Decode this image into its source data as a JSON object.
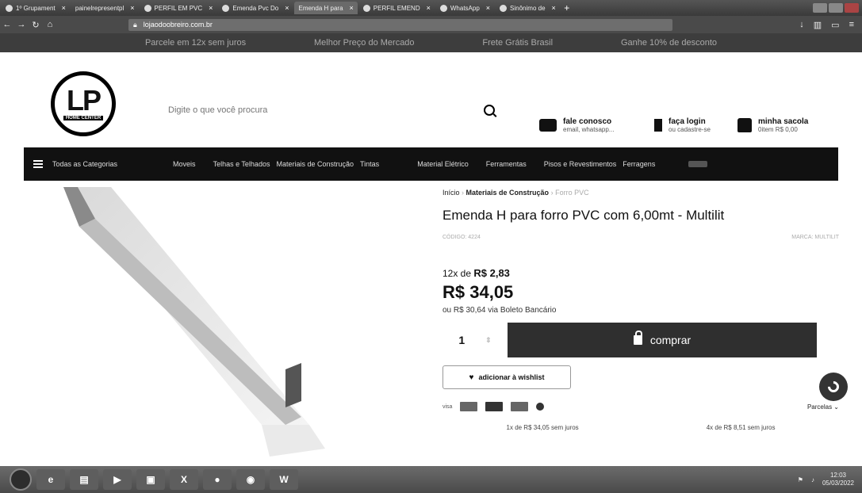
{
  "browser": {
    "tabs": [
      {
        "label": "1º Grupament"
      },
      {
        "label": "painelrepresentpl"
      },
      {
        "label": "PERFIL EM PVC"
      },
      {
        "label": "Emenda Pvc Do"
      },
      {
        "label": "Emenda H para"
      },
      {
        "label": "PERFIL EMEND"
      },
      {
        "label": "WhatsApp"
      },
      {
        "label": "Sinônimo de"
      }
    ],
    "url": "lojaodoobreiro.com.br"
  },
  "promo": {
    "items": [
      "Parcele em 12x sem juros",
      "Melhor Preço do Mercado",
      "Frete Grátis Brasil",
      "Ganhe 10% de desconto"
    ]
  },
  "header": {
    "logo_text": "LP",
    "logo_sub": "HOME CENTER",
    "search_placeholder": "Digite o que você procura",
    "contact_title": "fale conosco",
    "contact_sub": "email, whatsapp...",
    "login_title": "faça login",
    "login_sub": "ou cadastre-se",
    "bag_title": "minha sacola",
    "bag_sub": "0item R$ 0,00"
  },
  "nav": {
    "all": "Todas as Categorias",
    "items": [
      "Moveis",
      "Telhas e Telhados",
      "Materiais de Construção",
      "Tintas",
      "Material Elétrico",
      "Ferramentas",
      "Pisos e Revestimentos",
      "Ferragens"
    ]
  },
  "product": {
    "crumb_home": "Início",
    "crumb_cat": "Materiais de Construção",
    "crumb_current": "Forro PVC",
    "title": "Emenda H para forro PVC com 6,00mt - Multilit",
    "code": "CÓDIGO: 4224",
    "brand": "MARCA: MULTILIT",
    "installment_prefix": "12x de ",
    "installment_value": "R$ 2,83",
    "price": "R$ 34,05",
    "boleto": "ou R$ 30,64 via Boleto Bancário",
    "quantity": "1",
    "buy_label": "comprar",
    "wishlist_label": "adicionar à wishlist",
    "card_label": "visa",
    "parcelas_label": "Parcelas ⌄",
    "plan_1": "1x de R$ 34,05 sem juros",
    "plan_4": "4x de R$ 8,51 sem juros"
  },
  "taskbar": {
    "time": "12:03",
    "date": "05/03/2022"
  }
}
